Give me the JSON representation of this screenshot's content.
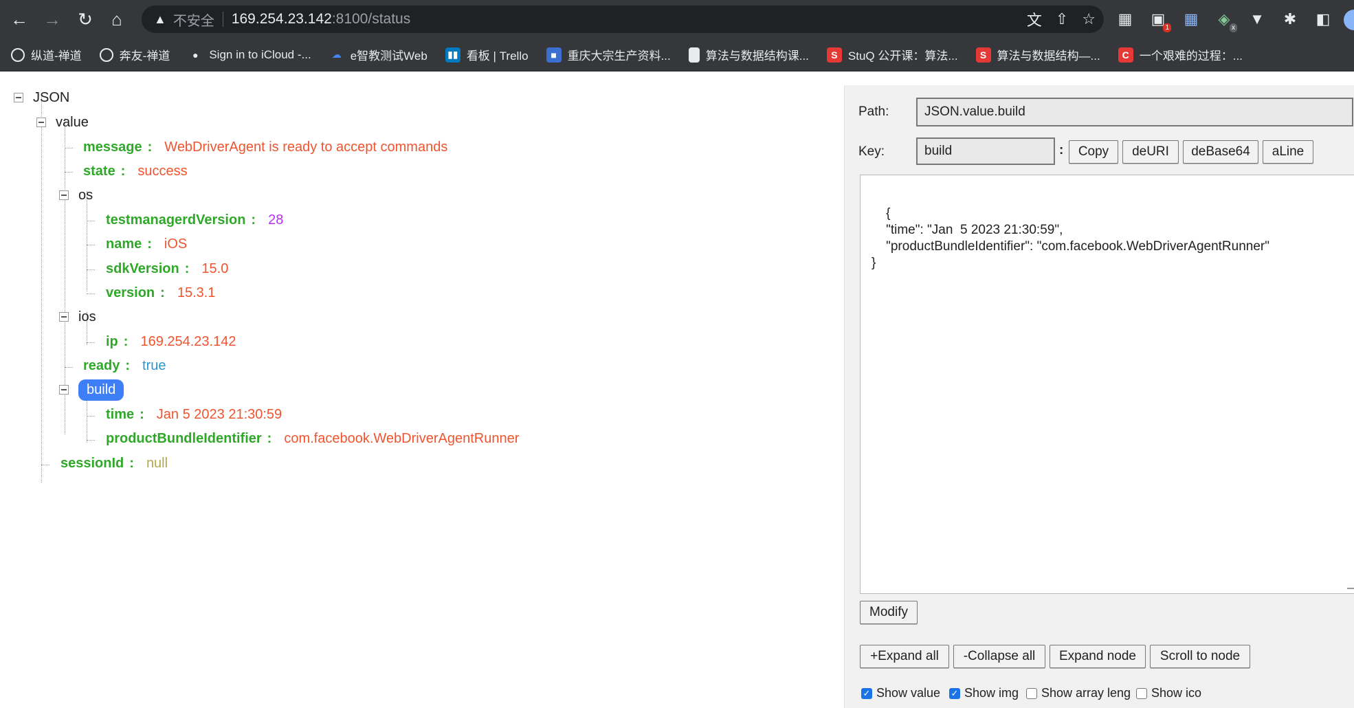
{
  "browser": {
    "security_label": "不安全",
    "url_host": "169.254.23.142",
    "url_rest": ":8100/status",
    "ext_badge": "1",
    "ext_x": "x",
    "bookmarks": [
      {
        "label": "纵道-禅道",
        "icon": "globe-icon",
        "color": "#5f6368"
      },
      {
        "label": "奔友-禅道",
        "icon": "globe-icon",
        "color": "#5f6368"
      },
      {
        "label": "Sign in to iCloud -...",
        "icon": "apple-icon",
        "color": "#5f6368"
      },
      {
        "label": "e智教测试Web",
        "icon": "cloud-icon",
        "color": "#4285f4"
      },
      {
        "label": "看板 | Trello",
        "icon": "trello-icon",
        "color": "#0079bf"
      },
      {
        "label": "重庆大宗生产资料...",
        "icon": "site-icon",
        "color": "#3b6fd1"
      },
      {
        "label": "算法与数据结构课...",
        "icon": "document-icon",
        "color": "#e8eaed"
      },
      {
        "label": "StuQ 公开课：算法...",
        "icon": "s-logo-icon",
        "color": "#e53935",
        "letter": "S"
      },
      {
        "label": "算法与数据结构—...",
        "icon": "s-logo-icon",
        "color": "#e53935",
        "letter": "S"
      },
      {
        "label": "一个艰难的过程：...",
        "icon": "c-logo-icon",
        "color": "#e53935",
        "letter": "C"
      }
    ]
  },
  "tree": {
    "root": "JSON",
    "value": "value",
    "message_key": "message",
    "message_val": "WebDriverAgent is ready to accept commands",
    "state_key": "state",
    "state_val": "success",
    "os": "os",
    "tmv_key": "testmanagerdVersion",
    "tmv_val": "28",
    "name_key": "name",
    "name_val": "iOS",
    "sdk_key": "sdkVersion",
    "sdk_val": "15.0",
    "version_key": "version",
    "version_val": "15.3.1",
    "ios": "ios",
    "ip_key": "ip",
    "ip_val": "169.254.23.142",
    "ready_key": "ready",
    "ready_val": "true",
    "build": "build",
    "time_key": "time",
    "time_val": "Jan 5 2023 21:30:59",
    "pbi_key": "productBundleIdentifier",
    "pbi_val": "com.facebook.WebDriverAgentRunner",
    "session_key": "sessionId",
    "session_val": "null",
    "colon": ":"
  },
  "panel": {
    "path_label": "Path:",
    "path_value": "JSON.value.build",
    "key_label": "Key:",
    "key_value": "build",
    "key_colon": ":",
    "copy": "Copy",
    "deuri": "deURI",
    "debase64": "deBase64",
    "aline": "aLine",
    "editor_text": "{\n    \"time\": \"Jan  5 2023 21:30:59\",\n    \"productBundleIdentifier\": \"com.facebook.WebDriverAgentRunner\"\n}",
    "modify": "Modify",
    "expand_all": "+Expand all",
    "collapse_all": "-Collapse all",
    "expand_node": "Expand node",
    "scroll_to_node": "Scroll to node",
    "show_value": "Show value",
    "show_img": "Show img",
    "show_array_leng": "Show array leng",
    "show_ico": "Show ico",
    "checked_mark": "✓"
  }
}
